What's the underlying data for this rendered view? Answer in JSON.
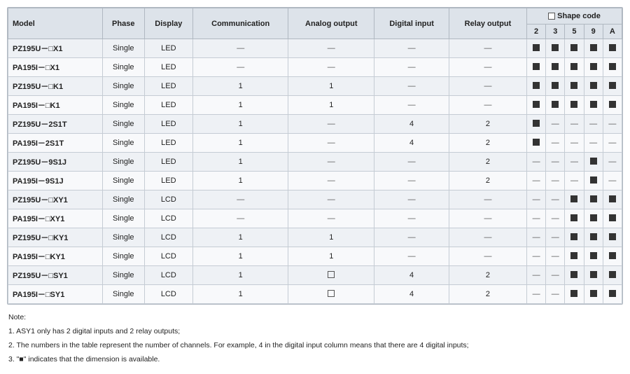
{
  "table": {
    "headers": {
      "model": "Model",
      "phase": "Phase",
      "display": "Display",
      "communication": "Communication",
      "analog_output": "Analog output",
      "digital_input": "Digital input",
      "relay_output": "Relay output",
      "shape_code": "Shape code",
      "shape_cols": [
        "2",
        "3",
        "5",
        "9",
        "A"
      ]
    },
    "rows": [
      {
        "model": "PZ195U－□X1",
        "phase": "Single",
        "display": "LED",
        "comm": "—",
        "analog": "—",
        "digital": "—",
        "relay": "—",
        "s2": "■",
        "s3": "■",
        "s5": "■",
        "s9": "■",
        "sA": "■"
      },
      {
        "model": "PA195I－□X1",
        "phase": "Single",
        "display": "LED",
        "comm": "—",
        "analog": "—",
        "digital": "—",
        "relay": "—",
        "s2": "■",
        "s3": "■",
        "s5": "■",
        "s9": "■",
        "sA": "■"
      },
      {
        "model": "PZ195U－□K1",
        "phase": "Single",
        "display": "LED",
        "comm": "1",
        "analog": "1",
        "digital": "—",
        "relay": "—",
        "s2": "■",
        "s3": "■",
        "s5": "■",
        "s9": "■",
        "sA": "■"
      },
      {
        "model": "PA195I－□K1",
        "phase": "Single",
        "display": "LED",
        "comm": "1",
        "analog": "1",
        "digital": "—",
        "relay": "—",
        "s2": "■",
        "s3": "■",
        "s5": "■",
        "s9": "■",
        "sA": "■"
      },
      {
        "model": "PZ195U－2S1T",
        "phase": "Single",
        "display": "LED",
        "comm": "1",
        "analog": "—",
        "digital": "4",
        "relay": "2",
        "s2": "■",
        "s3": "—",
        "s5": "—",
        "s9": "—",
        "sA": "—"
      },
      {
        "model": "PA195I－2S1T",
        "phase": "Single",
        "display": "LED",
        "comm": "1",
        "analog": "—",
        "digital": "4",
        "relay": "2",
        "s2": "■",
        "s3": "—",
        "s5": "—",
        "s9": "—",
        "sA": "—"
      },
      {
        "model": "PZ195U－9S1J",
        "phase": "Single",
        "display": "LED",
        "comm": "1",
        "analog": "—",
        "digital": "—",
        "relay": "2",
        "s2": "—",
        "s3": "—",
        "s5": "—",
        "s9": "■",
        "sA": "—"
      },
      {
        "model": "PA195I－9S1J",
        "phase": "Single",
        "display": "LED",
        "comm": "1",
        "analog": "—",
        "digital": "—",
        "relay": "2",
        "s2": "—",
        "s3": "—",
        "s5": "—",
        "s9": "■",
        "sA": "—"
      },
      {
        "model": "PZ195U－□XY1",
        "phase": "Single",
        "display": "LCD",
        "comm": "—",
        "analog": "—",
        "digital": "—",
        "relay": "—",
        "s2": "—",
        "s3": "—",
        "s5": "■",
        "s9": "■",
        "sA": "■"
      },
      {
        "model": "PA195I－□XY1",
        "phase": "Single",
        "display": "LCD",
        "comm": "—",
        "analog": "—",
        "digital": "—",
        "relay": "—",
        "s2": "—",
        "s3": "—",
        "s5": "■",
        "s9": "■",
        "sA": "■"
      },
      {
        "model": "PZ195U－□KY1",
        "phase": "Single",
        "display": "LCD",
        "comm": "1",
        "analog": "1",
        "digital": "—",
        "relay": "—",
        "s2": "—",
        "s3": "—",
        "s5": "■",
        "s9": "■",
        "sA": "■"
      },
      {
        "model": "PA195I－□KY1",
        "phase": "Single",
        "display": "LCD",
        "comm": "1",
        "analog": "1",
        "digital": "—",
        "relay": "—",
        "s2": "—",
        "s3": "—",
        "s5": "■",
        "s9": "■",
        "sA": "■"
      },
      {
        "model": "PZ195U－□SY1",
        "phase": "Single",
        "display": "LCD",
        "comm": "1",
        "analog": "□",
        "digital": "4",
        "relay": "2",
        "s2": "—",
        "s3": "—",
        "s5": "■",
        "s9": "■",
        "sA": "■"
      },
      {
        "model": "PA195I－□SY1",
        "phase": "Single",
        "display": "LCD",
        "comm": "1",
        "analog": "□",
        "digital": "4",
        "relay": "2",
        "s2": "—",
        "s3": "—",
        "s5": "■",
        "s9": "■",
        "sA": "■"
      }
    ],
    "notes": [
      "Note:",
      "1. ASY1 only has 2 digital inputs and 2 relay outputs;",
      "2. The numbers in the table represent the number of channels. For example, 4 in the digital input column means that there are 4 digital inputs;",
      "3. \"■\" indicates that the dimension is available."
    ]
  }
}
